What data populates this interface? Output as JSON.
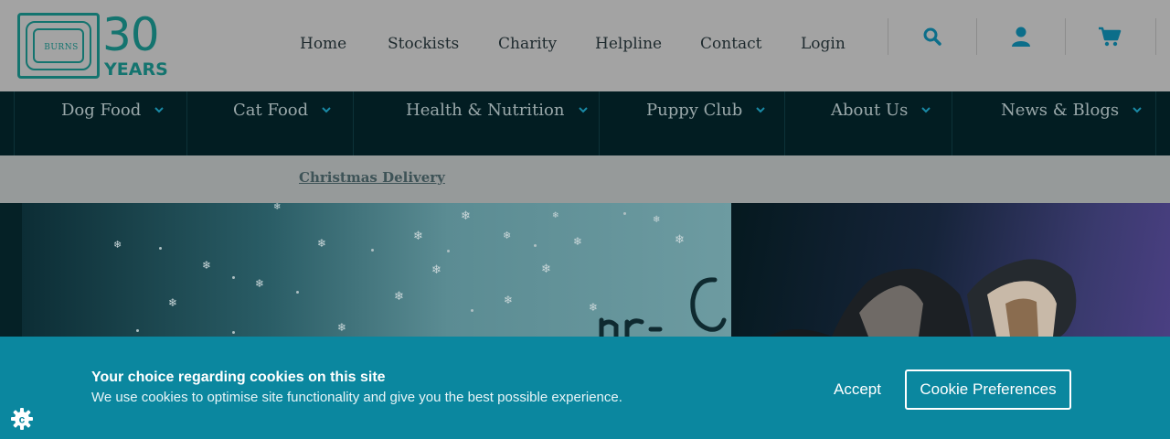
{
  "header": {
    "logo": {
      "brand_text": "BURNS",
      "number": "30",
      "years": "YEARS"
    },
    "top_nav": [
      {
        "label": "Home"
      },
      {
        "label": "Stockists"
      },
      {
        "label": "Charity"
      },
      {
        "label": "Helpline"
      },
      {
        "label": "Contact"
      },
      {
        "label": "Login"
      }
    ],
    "tools": [
      "search-icon",
      "account-icon",
      "cart-icon"
    ]
  },
  "category_nav": [
    {
      "label": "Dog Food"
    },
    {
      "label": "Cat Food"
    },
    {
      "label": "Health & Nutrition"
    },
    {
      "label": "Puppy Club"
    },
    {
      "label": "About Us"
    },
    {
      "label": "News & Blogs"
    }
  ],
  "promo": {
    "link_text": "Christmas Delivery "
  },
  "cookie_banner": {
    "title": "Your choice regarding cookies on this site",
    "text": "We use cookies to optimise site functionality and give you the best possible experience.",
    "accept_label": "Accept",
    "preferences_label": "Cookie Preferences"
  },
  "colors": {
    "brand_teal": "#14746f",
    "nav_dark": "#021d22",
    "cookie_bg": "#0b879f"
  }
}
